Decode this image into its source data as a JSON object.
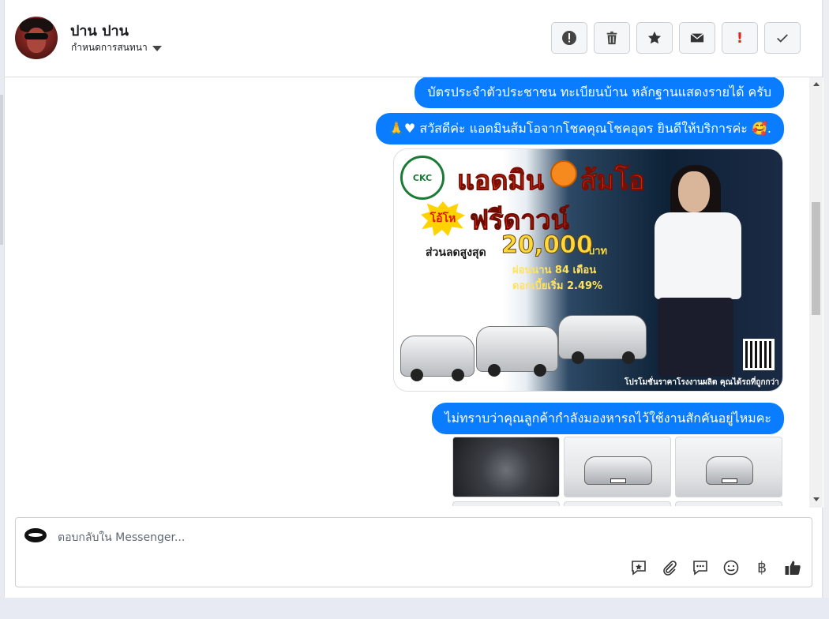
{
  "header": {
    "contact_name": "ปาน ปาน",
    "assign_label": "กำหนดการสนทนา",
    "actions": [
      {
        "name": "report-icon",
        "glyph": "!"
      },
      {
        "name": "trash-icon",
        "glyph": "🗑"
      },
      {
        "name": "star-icon",
        "glyph": "★"
      },
      {
        "name": "mail-icon",
        "glyph": "✉"
      },
      {
        "name": "important-icon",
        "glyph": "!"
      },
      {
        "name": "check-icon",
        "glyph": "✓"
      }
    ]
  },
  "messages": [
    {
      "text": "บัตรประจำตัวประชาชน ทะเบียนบ้าน หลักฐานแสดงรายได้ ครับ"
    },
    {
      "text": "🙏♥ สวัสดีค่ะ แอดมินส้มโอจากโชคคุณโชคอุดร ยินดีให้บริการค่ะ 🥰."
    },
    {
      "text": "ไม่ทราบว่าคุณลูกค้ากำลังมองหารถไว้ใช้งานสักคันอยู่ไหมคะ"
    }
  ],
  "promo_image": {
    "logo_text": "CKC",
    "line1a": "แอดมิน",
    "line1b": "ส้มโอ",
    "burst_text": "โอ้โห",
    "line2": "ฟรีดาวน์",
    "line3": "ส่วนลดสูงสุด",
    "price": "20,000",
    "price_unit": "บาท",
    "line4": "ผ่อนนาน 84 เดือน",
    "line5": "ดอกเบี้ยเริ่ม 2.49%",
    "footer": "โปรโมชั่นราคาโรงงานผลิต คุณได้รถที่ถูกกว่า"
  },
  "composer": {
    "placeholder": "ตอบกลับใน Messenger...",
    "tools": [
      "saved-reply-icon",
      "attachment-icon",
      "comment-icon",
      "emoji-icon",
      "baht-icon",
      "like-icon"
    ]
  },
  "colors": {
    "bubble": "#0a7cff",
    "accent_red": "#e0241b"
  }
}
